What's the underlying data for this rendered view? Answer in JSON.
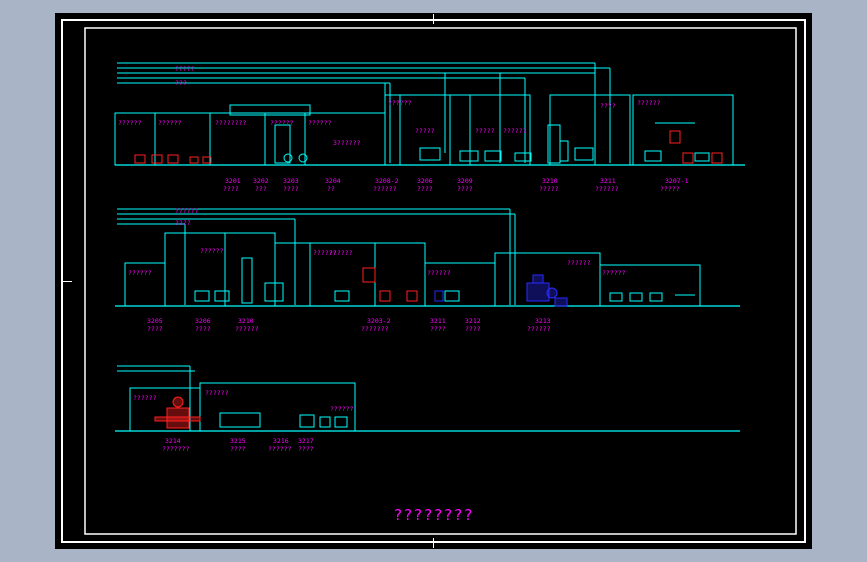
{
  "drawing": {
    "title": "????????",
    "colors": {
      "frame": "#ffffff",
      "line": "#00ffff",
      "label": "#ff00ff",
      "equipment_red": "#ff2020",
      "equipment_blue": "#2a2aff",
      "background": "#000000",
      "paper": "#a9b4c6"
    }
  },
  "row1": {
    "areas": [
      "??????",
      "??????",
      "????????",
      "??????",
      "??????",
      "??????",
      "?????",
      "?????",
      "??????",
      "????",
      "??????"
    ],
    "tags": [
      "3201",
      "3202",
      "3203",
      "3204",
      "3206",
      "3208-2",
      "3209",
      "3210",
      "3211",
      "3207-1"
    ],
    "names": [
      "????",
      "???",
      "????",
      "??",
      "????",
      "??????",
      "????",
      "?????",
      "??????",
      "?????"
    ],
    "extra": [
      "?????",
      "???"
    ],
    "area_extra": "3??????"
  },
  "row2": {
    "areas": [
      "??????",
      "??????",
      "??????",
      "??????",
      "??????",
      "??????",
      "??????"
    ],
    "tags": [
      "3205",
      "3206",
      "3210",
      "3211",
      "3212",
      "3203-2",
      "3213"
    ],
    "names": [
      "????",
      "????",
      "??????",
      "????",
      "????",
      "???????",
      "??????"
    ],
    "extra": [
      "??????",
      "????"
    ]
  },
  "row3": {
    "areas": [
      "??????",
      "??????",
      "??????"
    ],
    "tags": [
      "3214",
      "3215",
      "3216",
      "3217"
    ],
    "names": [
      "???????",
      "????",
      "??????",
      "????"
    ]
  }
}
